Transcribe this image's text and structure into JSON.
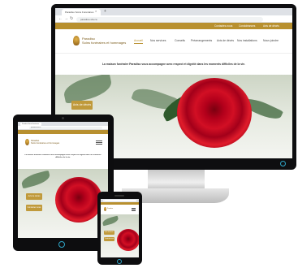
{
  "browser": {
    "tab_title": "Paradiso Soins Funéraires",
    "url": "paradiso-sfa.ca",
    "new_tab_symbol": "+",
    "close_symbol": "×",
    "back_symbol": "←",
    "forward_symbol": "→",
    "reload_symbol": "↻"
  },
  "site": {
    "top_links": [
      "Contactez-nous",
      "Condoléances",
      "Avis de décès"
    ],
    "logo_line1": "Paradiso",
    "logo_line2": "Soins funéraires et hommages",
    "nav": [
      "Accueil",
      "Nos services",
      "Conseils",
      "Préarrangements",
      "Avis de décès",
      "Nos installations",
      "Nous joindre"
    ],
    "tagline": "La maison funéraire Paradiso vous accompagne avec respect et dignité dans les moments difficiles de la vie.",
    "hero_buttons": [
      "Avis de décès",
      "Contactez-nous"
    ]
  },
  "colors": {
    "accent_gold": "#b8902f",
    "rose_red": "#c8101f",
    "device_black": "#0d0d0f",
    "home_button_ring": "#2fa6c8"
  }
}
